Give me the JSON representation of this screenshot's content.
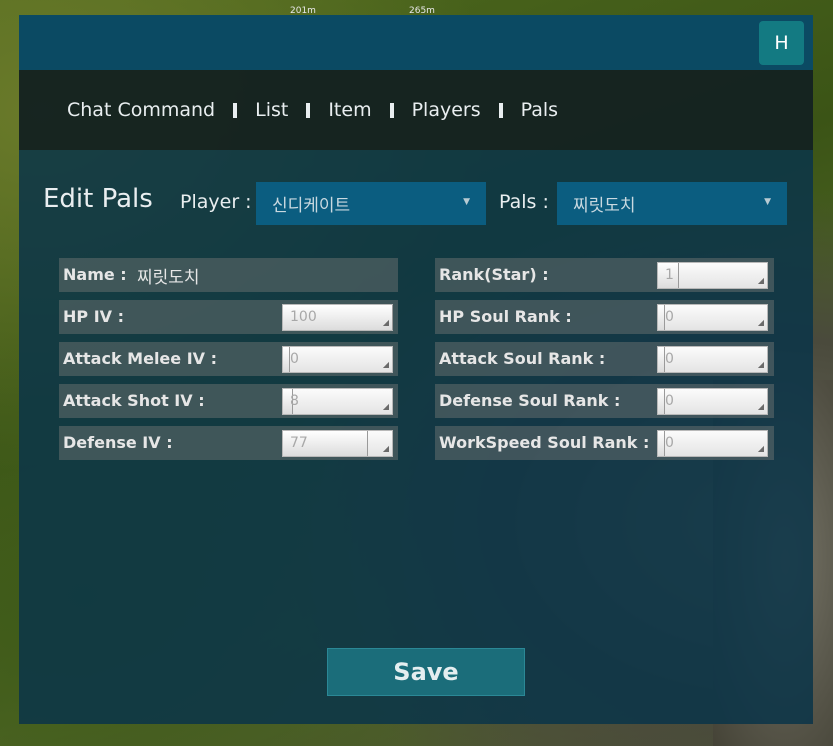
{
  "hud": {
    "distance_left": "201m",
    "distance_right": "265m"
  },
  "header": {
    "user_button_label": "H"
  },
  "nav": {
    "items": [
      "Chat Command",
      "List",
      "Item",
      "Players",
      "Pals"
    ]
  },
  "editor": {
    "title": "Edit Pals",
    "player_label": "Player :",
    "player_value": "신디케이트",
    "pals_label": "Pals :",
    "pals_value": "찌릿도치"
  },
  "left_fields": [
    {
      "label": "Name :",
      "value": "찌릿도치"
    },
    {
      "label": "HP IV :",
      "value": "100",
      "fill": 1.0
    },
    {
      "label": "Attack Melee IV :",
      "value": "0",
      "fill": 0.0
    },
    {
      "label": "Attack Shot IV :",
      "value": "8",
      "fill": 0.08
    },
    {
      "label": "Defense IV :",
      "value": "77",
      "fill": 0.77
    }
  ],
  "right_fields": [
    {
      "label": "Rank(Star) :",
      "value": "1",
      "fill": 0.18
    },
    {
      "label": "HP Soul Rank :",
      "value": "0",
      "fill": 0.0
    },
    {
      "label": "Attack Soul Rank :",
      "value": "0",
      "fill": 0.0
    },
    {
      "label": "Defense Soul Rank :",
      "value": "0",
      "fill": 0.0
    },
    {
      "label": "WorkSpeed Soul Rank :",
      "value": "0",
      "fill": 0.0
    }
  ],
  "actions": {
    "save_label": "Save"
  }
}
